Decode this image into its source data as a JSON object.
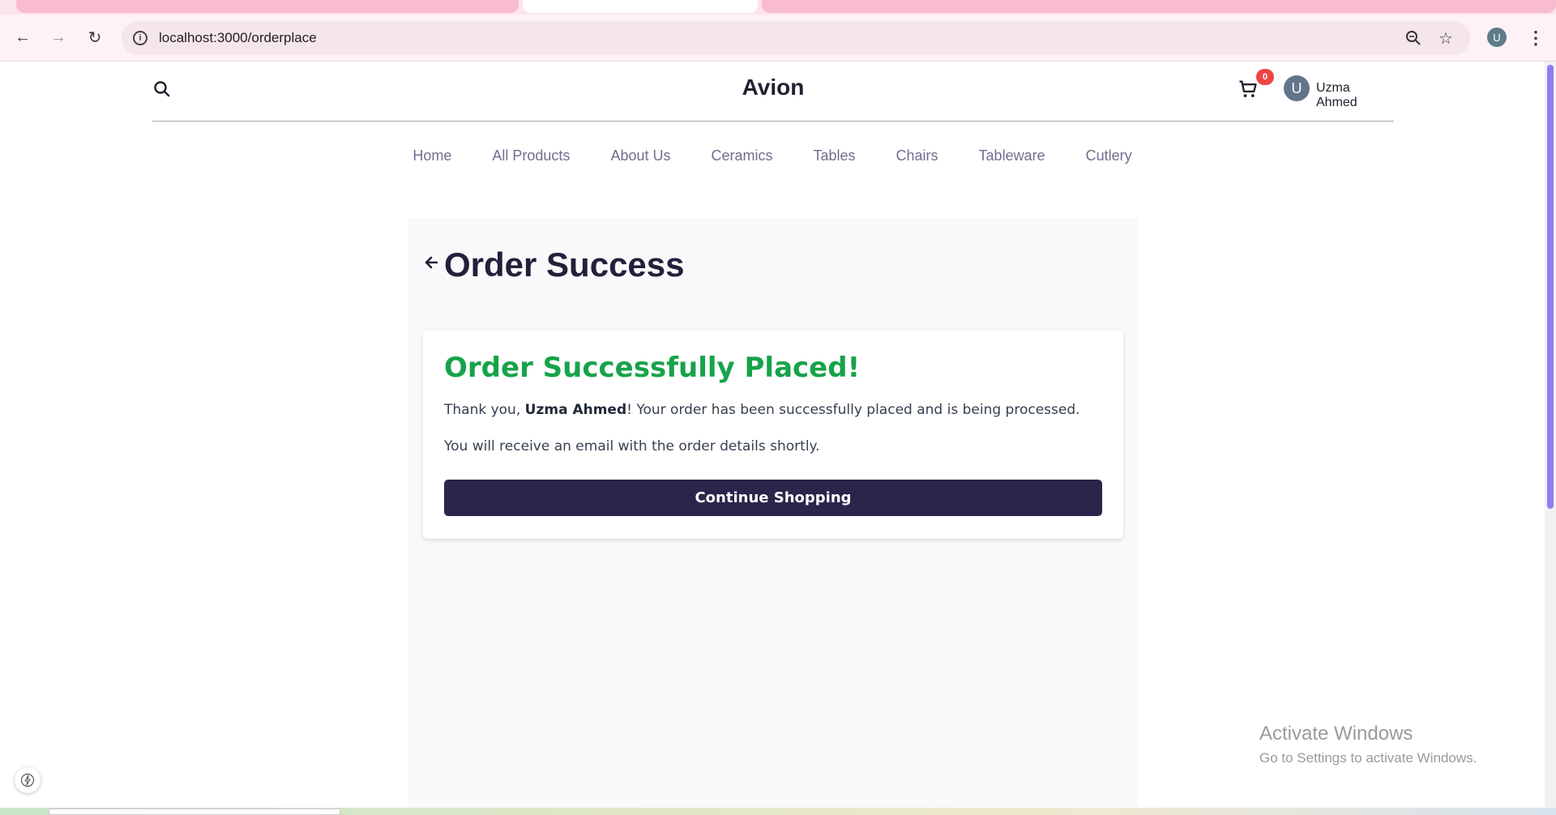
{
  "browser": {
    "url": "localhost:3000/orderplace",
    "profile_initial": "U"
  },
  "header": {
    "brand": "Avion",
    "cart_count": "0",
    "user_initial": "U",
    "user_name": "Uzma Ahmed"
  },
  "nav": {
    "items": [
      "Home",
      "All Products",
      "About Us",
      "Ceramics",
      "Tables",
      "Chairs",
      "Tableware",
      "Cutlery"
    ]
  },
  "main": {
    "title": "Order Success",
    "card": {
      "heading": "Order Successfully Placed!",
      "thanks_prefix": "Thank you, ",
      "customer_name": "Uzma Ahmed",
      "thanks_suffix": "! Your order has been successfully placed and is being processed.",
      "email_note": "You will receive an email with the order details shortly.",
      "button_label": "Continue Shopping"
    }
  },
  "watermark": {
    "line1": "Activate Windows",
    "line2": "Go to Settings to activate Windows."
  },
  "colors": {
    "accent": "#2a254b",
    "success": "#16a34a",
    "badge": "#ef4444"
  }
}
